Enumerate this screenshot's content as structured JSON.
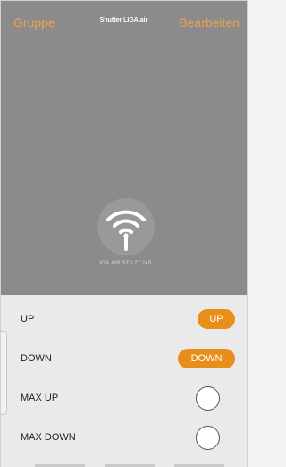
{
  "nav": {
    "left_label": "Gruppe",
    "title": "Shutter LIGA.air",
    "right_label": "Bearbeiten",
    "accent_color": "#f0a24a"
  },
  "device": {
    "icon": "wifi-icon",
    "rating_stars": "★★★★",
    "label": "LIGA.AIR.ST0.2T.240"
  },
  "controls": {
    "accent_color": "#e88e1a",
    "rows": [
      {
        "label": "UP",
        "button_label": "UP"
      },
      {
        "label": "DOWN",
        "button_label": "DOWN"
      },
      {
        "label": "MAX UP",
        "toggle_state": "off"
      },
      {
        "label": "MAX DOWN",
        "toggle_state": "off"
      }
    ]
  }
}
